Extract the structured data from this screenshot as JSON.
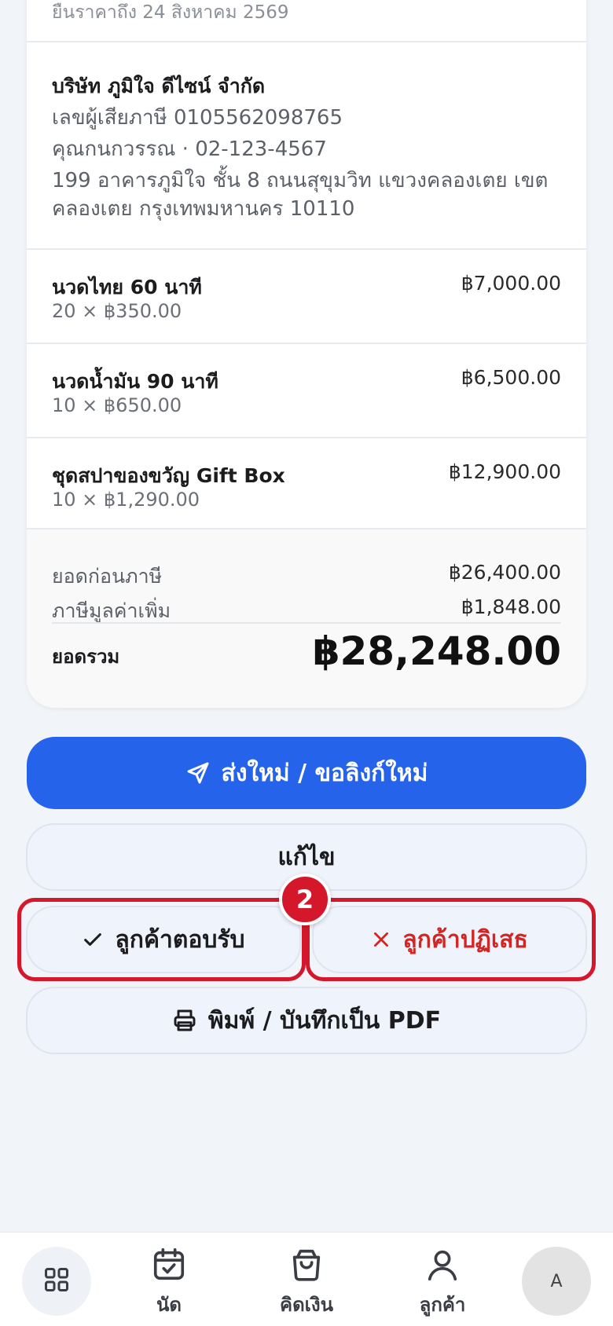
{
  "quote": {
    "expiry_text": "ยืนราคาถึง 24 สิงหาคม 2569"
  },
  "company": {
    "name": "บริษัท ภูมิใจ ดีไซน์ จำกัด",
    "tax_id": "เลขผู้เสียภาษี 0105562098765",
    "contact": "คุณกนกวรรณ · 02-123-4567",
    "address": "199 อาคารภูมิใจ ชั้น 8 ถนนสุขุมวิท แขวงคลองเตย เขตคลองเตย กรุงเทพมหานคร 10110"
  },
  "items": [
    {
      "name": "นวดไทย 60 นาที",
      "qty": "20 × ฿350.00",
      "total": "฿7,000.00"
    },
    {
      "name": "นวดน้ำมัน 90 นาที",
      "qty": "10 × ฿650.00",
      "total": "฿6,500.00"
    },
    {
      "name": "ชุดสปาของขวัญ Gift Box",
      "qty": "10 × ฿1,290.00",
      "total": "฿12,900.00"
    }
  ],
  "totals": {
    "subtotal_label": "ยอดก่อนภาษี",
    "subtotal_value": "฿26,400.00",
    "vat_label": "ภาษีมูลค่าเพิ่ม",
    "vat_value": "฿1,848.00",
    "grand_label": "ยอดรวม",
    "grand_value": "฿28,248.00"
  },
  "actions": {
    "resend_label": "ส่งใหม่ / ขอลิงก์ใหม่",
    "edit_label": "แก้ไข",
    "accept_label": "ลูกค้าตอบรับ",
    "reject_label": "ลูกค้าปฏิเสธ",
    "print_label": "พิมพ์ / บันทึกเป็น PDF"
  },
  "annotation": {
    "step_number": "2"
  },
  "nav": {
    "items": [
      {
        "label": "นัด",
        "icon": "calendar-check-icon"
      },
      {
        "label": "คิดเงิน",
        "icon": "shopping-bag-icon"
      },
      {
        "label": "ลูกค้า",
        "icon": "user-icon"
      }
    ],
    "avatar_initial": "A"
  },
  "colors": {
    "primary": "#2563eb",
    "danger": "#d42525",
    "highlight": "#d5172b",
    "background": "#f1f4f9"
  }
}
